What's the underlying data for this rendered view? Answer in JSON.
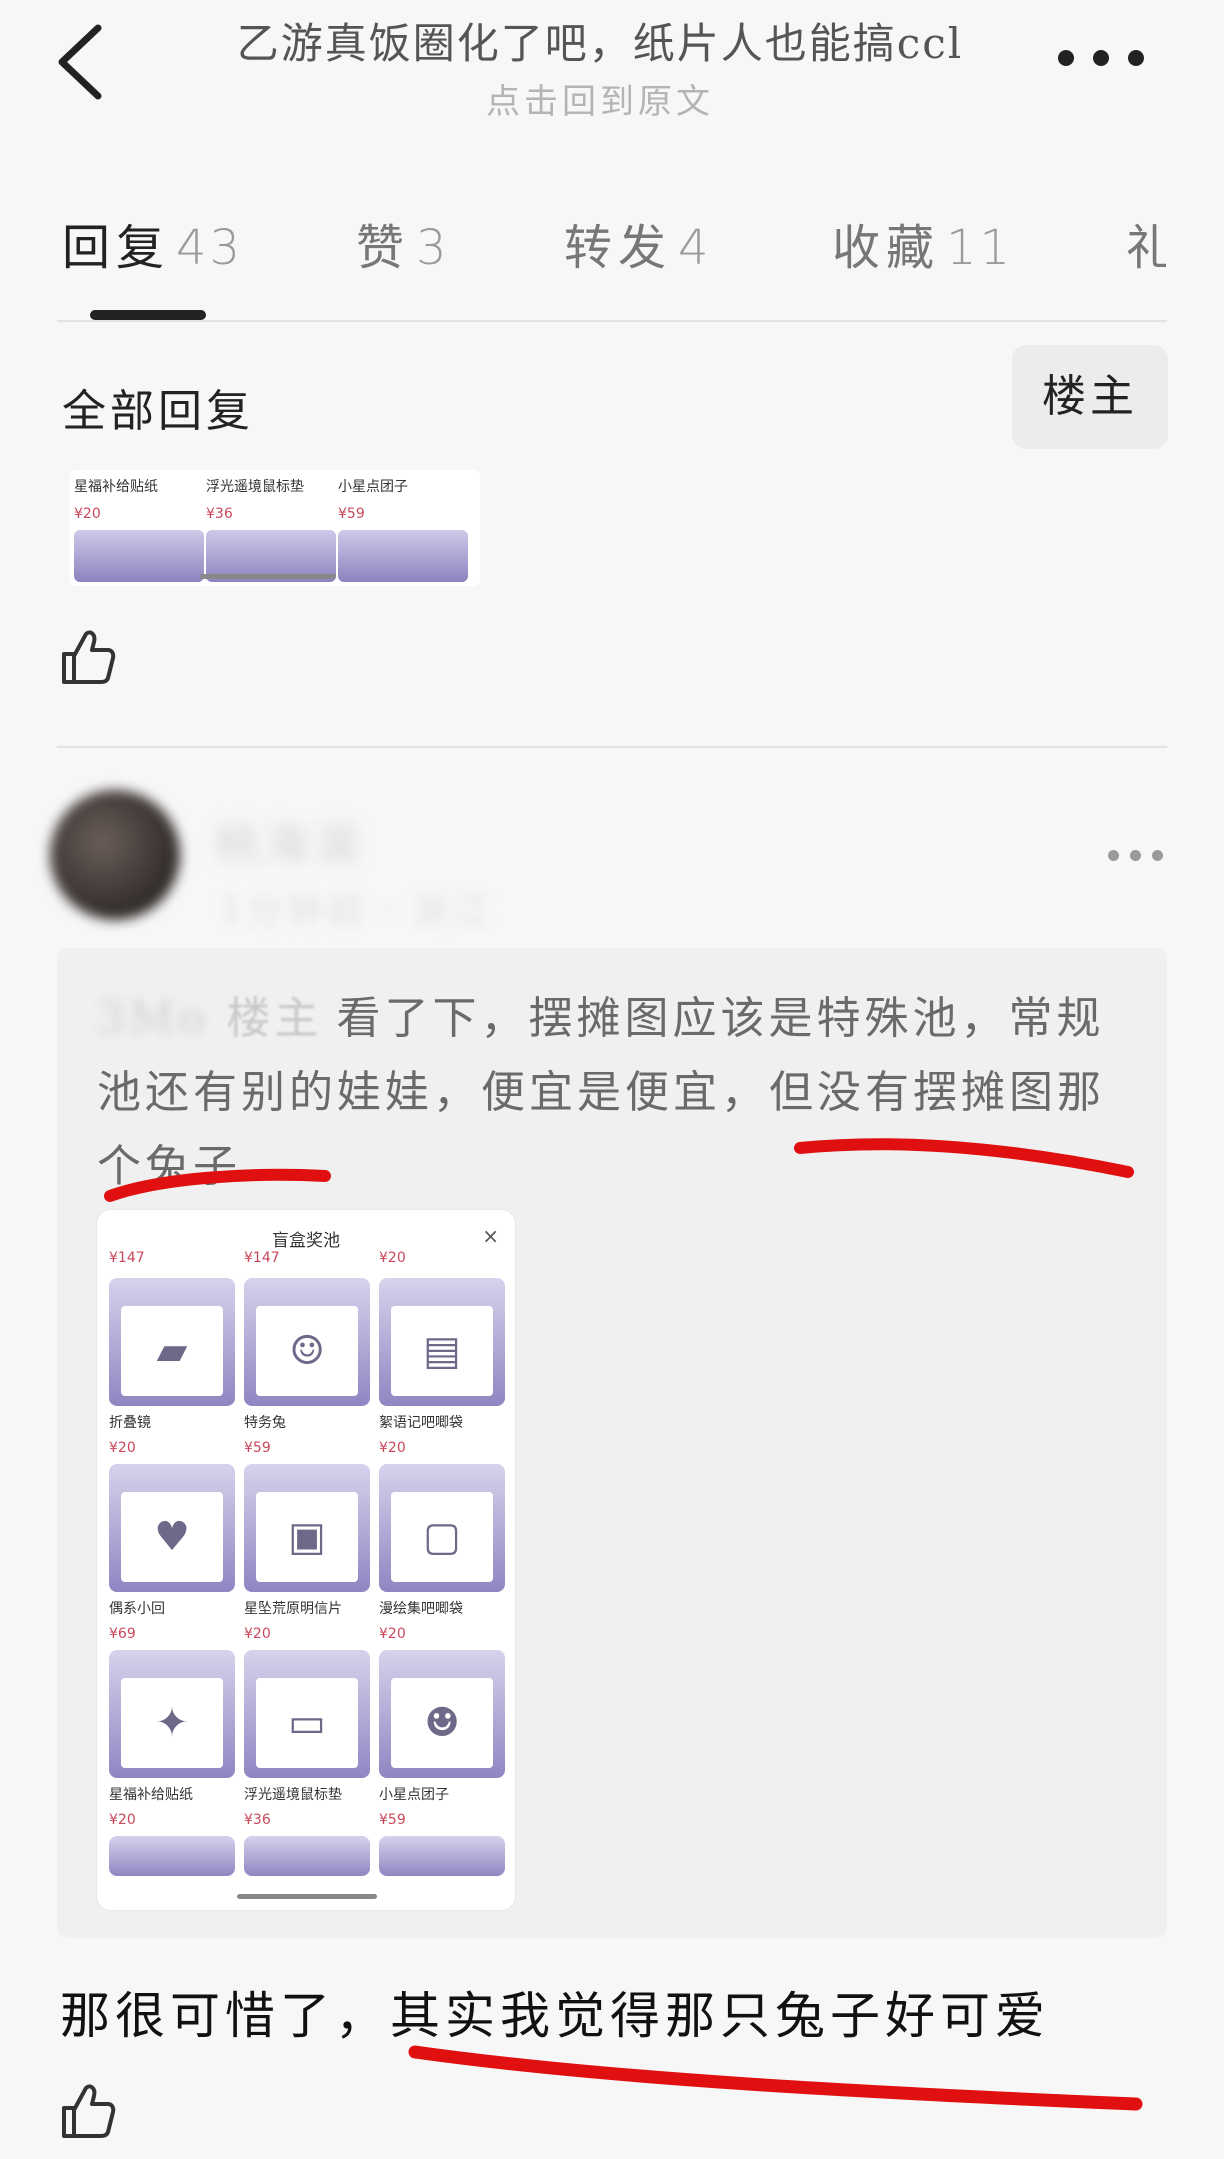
{
  "header": {
    "title": "乙游真饭圈化了吧，纸片人也能搞ccl",
    "subtitle": "点击回到原文"
  },
  "tabs": [
    {
      "label": "回复",
      "count": "43"
    },
    {
      "label": "赞",
      "count": "3"
    },
    {
      "label": "转发",
      "count": "4"
    },
    {
      "label": "收藏",
      "count": "11"
    },
    {
      "label": "礼",
      "count": ""
    }
  ],
  "section": {
    "all_replies_label": "全部回复",
    "op_filter_label": "楼主"
  },
  "product_strip": [
    {
      "name": "星福补给贴纸",
      "price": "¥20"
    },
    {
      "name": "浮光遥境鼠标垫",
      "price": "¥36"
    },
    {
      "name": "小星点团子",
      "price": "¥59"
    }
  ],
  "comment": {
    "username": "桃海滋",
    "meta": "1分钟前 · 浙江",
    "quote": {
      "author": "3Mo",
      "op_tag": "楼主",
      "text": "看了下，摆摊图应该是特殊池，常规池还有别的娃娃，便宜是便宜，但没有摆摊图那个兔子"
    },
    "embedded_screenshot": {
      "title": "盲盒奖池",
      "close": "×",
      "top_prices": [
        "¥147",
        "¥147",
        "¥20"
      ],
      "items": [
        {
          "name": "折叠镜",
          "price": "¥20",
          "glyph": "▰"
        },
        {
          "name": "特务兔",
          "price": "¥59",
          "glyph": "☺"
        },
        {
          "name": "絮语记吧唧袋",
          "price": "¥20",
          "glyph": "▤"
        },
        {
          "name": "偶系小回",
          "price": "¥69",
          "glyph": "♥"
        },
        {
          "name": "星坠荒原明信片",
          "price": "¥20",
          "glyph": "▣"
        },
        {
          "name": "漫绘集吧唧袋",
          "price": "¥20",
          "glyph": "▢"
        },
        {
          "name": "星福补给贴纸",
          "price": "¥20",
          "glyph": "✦"
        },
        {
          "name": "浮光遥境鼠标垫",
          "price": "¥36",
          "glyph": "▭"
        },
        {
          "name": "小星点团子",
          "price": "¥59",
          "glyph": "☻"
        }
      ]
    },
    "reply": "那很可惜了，其实我觉得那只兔子好可爱"
  },
  "colors": {
    "background": "#f7f7f7",
    "price": "#c9485b",
    "annotation": "#e01010"
  }
}
